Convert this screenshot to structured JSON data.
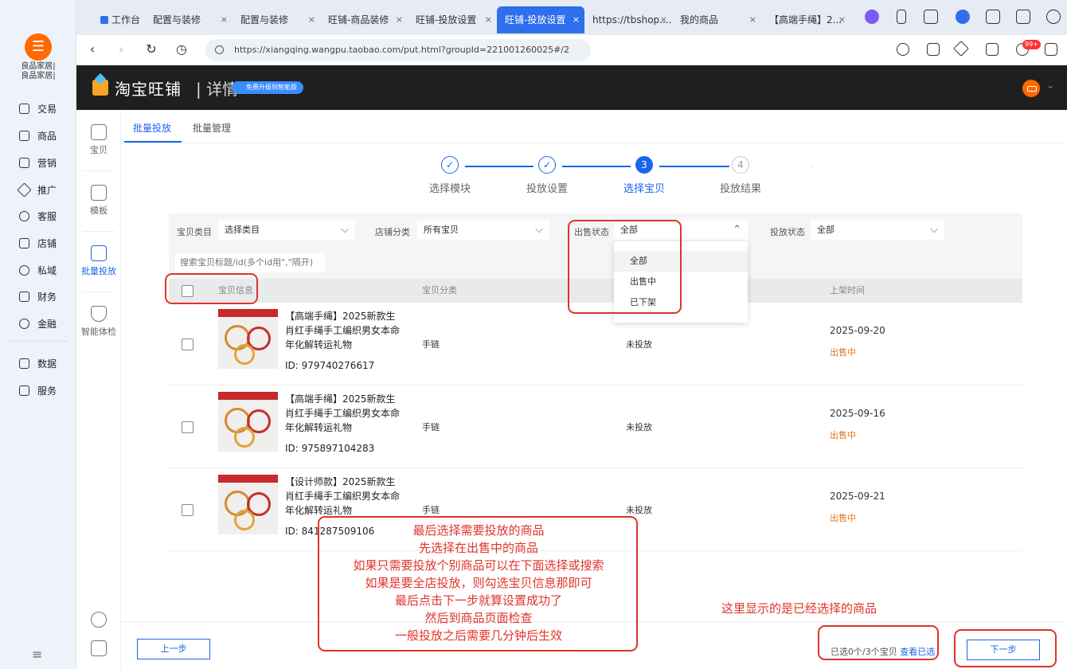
{
  "browser": {
    "tabs": [
      {
        "label": "工作台",
        "active": false
      },
      {
        "label": "配置与装修",
        "active": false
      },
      {
        "label": "配置与装修",
        "active": false
      },
      {
        "label": "旺铺-商品装修",
        "active": false
      },
      {
        "label": "旺铺-投放设置",
        "active": false
      },
      {
        "label": "旺铺-投放设置",
        "active": true
      },
      {
        "label": "https://tbshop....",
        "active": false
      },
      {
        "label": "我的商品",
        "active": false
      },
      {
        "label": "【高端手绳】2...",
        "active": false
      }
    ],
    "close_glyph": "×",
    "url": "https://xiangqing.wangpu.taobao.com/put.html?groupId=221001260025#/2",
    "notification_badge": "99+",
    "nav": {
      "back": "‹",
      "forward": "›",
      "reload": "↻",
      "history": "◷"
    }
  },
  "app_sidebar": {
    "shop_name_1": "良品家居|",
    "shop_name_2": "良品家居|",
    "items": [
      "交易",
      "商品",
      "营销",
      "推广",
      "客服",
      "店铺",
      "私域",
      "财务",
      "金融",
      "数据",
      "服务"
    ],
    "menu_glyph": "≡"
  },
  "header": {
    "brand": "淘宝旺铺",
    "section": "| 详情",
    "promo": "免费升级到智能版"
  },
  "subnav": {
    "items": [
      "宝贝",
      "模板",
      "批量投放",
      "智能体检"
    ],
    "active": "批量投放"
  },
  "page_tabs": {
    "tab1": "批量投放",
    "tab2": "批量管理"
  },
  "steps": [
    {
      "label": "选择模块",
      "state": "done"
    },
    {
      "label": "投放设置",
      "state": "done"
    },
    {
      "label": "选择宝贝",
      "state": "current",
      "num": "3"
    },
    {
      "label": "投放结果",
      "state": "todo",
      "num": "4"
    }
  ],
  "check_glyph": "✓",
  "filters": {
    "category_label": "宝贝类目",
    "category_value": "选择类目",
    "shop_cat_label": "店铺分类",
    "shop_cat_value": "所有宝贝",
    "sale_status_label": "出售状态",
    "sale_status_value": "全部",
    "put_status_label": "投放状态",
    "put_status_value": "全部",
    "search_placeholder": "搜索宝贝标题/id(多个id用\",\"隔开)"
  },
  "dropdown": {
    "options": [
      "全部",
      "出售中",
      "已下架"
    ],
    "selected": "全部"
  },
  "table": {
    "columns": {
      "info": "宝贝信息",
      "category": "宝贝分类",
      "time": "上架时间"
    },
    "rows": [
      {
        "title": "【高端手绳】2025新款生肖红手绳手工编织男女本命年化解转运礼物",
        "id": "ID: 979740276617",
        "category": "手链",
        "put_status": "未投放",
        "date": "2025-09-20",
        "sale": "出售中"
      },
      {
        "title": "【高端手绳】2025新款生肖红手绳手工编织男女本命年化解转运礼物",
        "id": "ID: 975897104283",
        "category": "手链",
        "put_status": "未投放",
        "date": "2025-09-16",
        "sale": "出售中"
      },
      {
        "title": "【设计师款】2025新款生肖红手绳手工编织男女本命年化解转运礼物",
        "id": "ID: 841287509106",
        "category": "手链",
        "put_status": "未投放",
        "date": "2025-09-21",
        "sale": "出售中"
      }
    ]
  },
  "footer": {
    "prev": "上一步",
    "next": "下一步",
    "selected_text": "已选0个/3个宝贝",
    "view_selected": "查看已选"
  },
  "annotations": {
    "main_lines": [
      "最后选择需要投放的商品",
      "先选择在出售中的商品",
      "如果只需要投放个别商品可以在下面选择或搜索",
      "如果是要全店投放，则勾选宝贝信息那即可",
      "最后点击下一步就算设置成功了",
      "然后到商品页面检查",
      "一般投放之后需要几分钟后生效"
    ],
    "right_note": "这里显示的是已经选择的商品"
  },
  "colors": {
    "accent": "#1a66e8",
    "annotation": "#e0342a",
    "sale": "#e8731a",
    "brand_orange": "#ff6a00"
  }
}
